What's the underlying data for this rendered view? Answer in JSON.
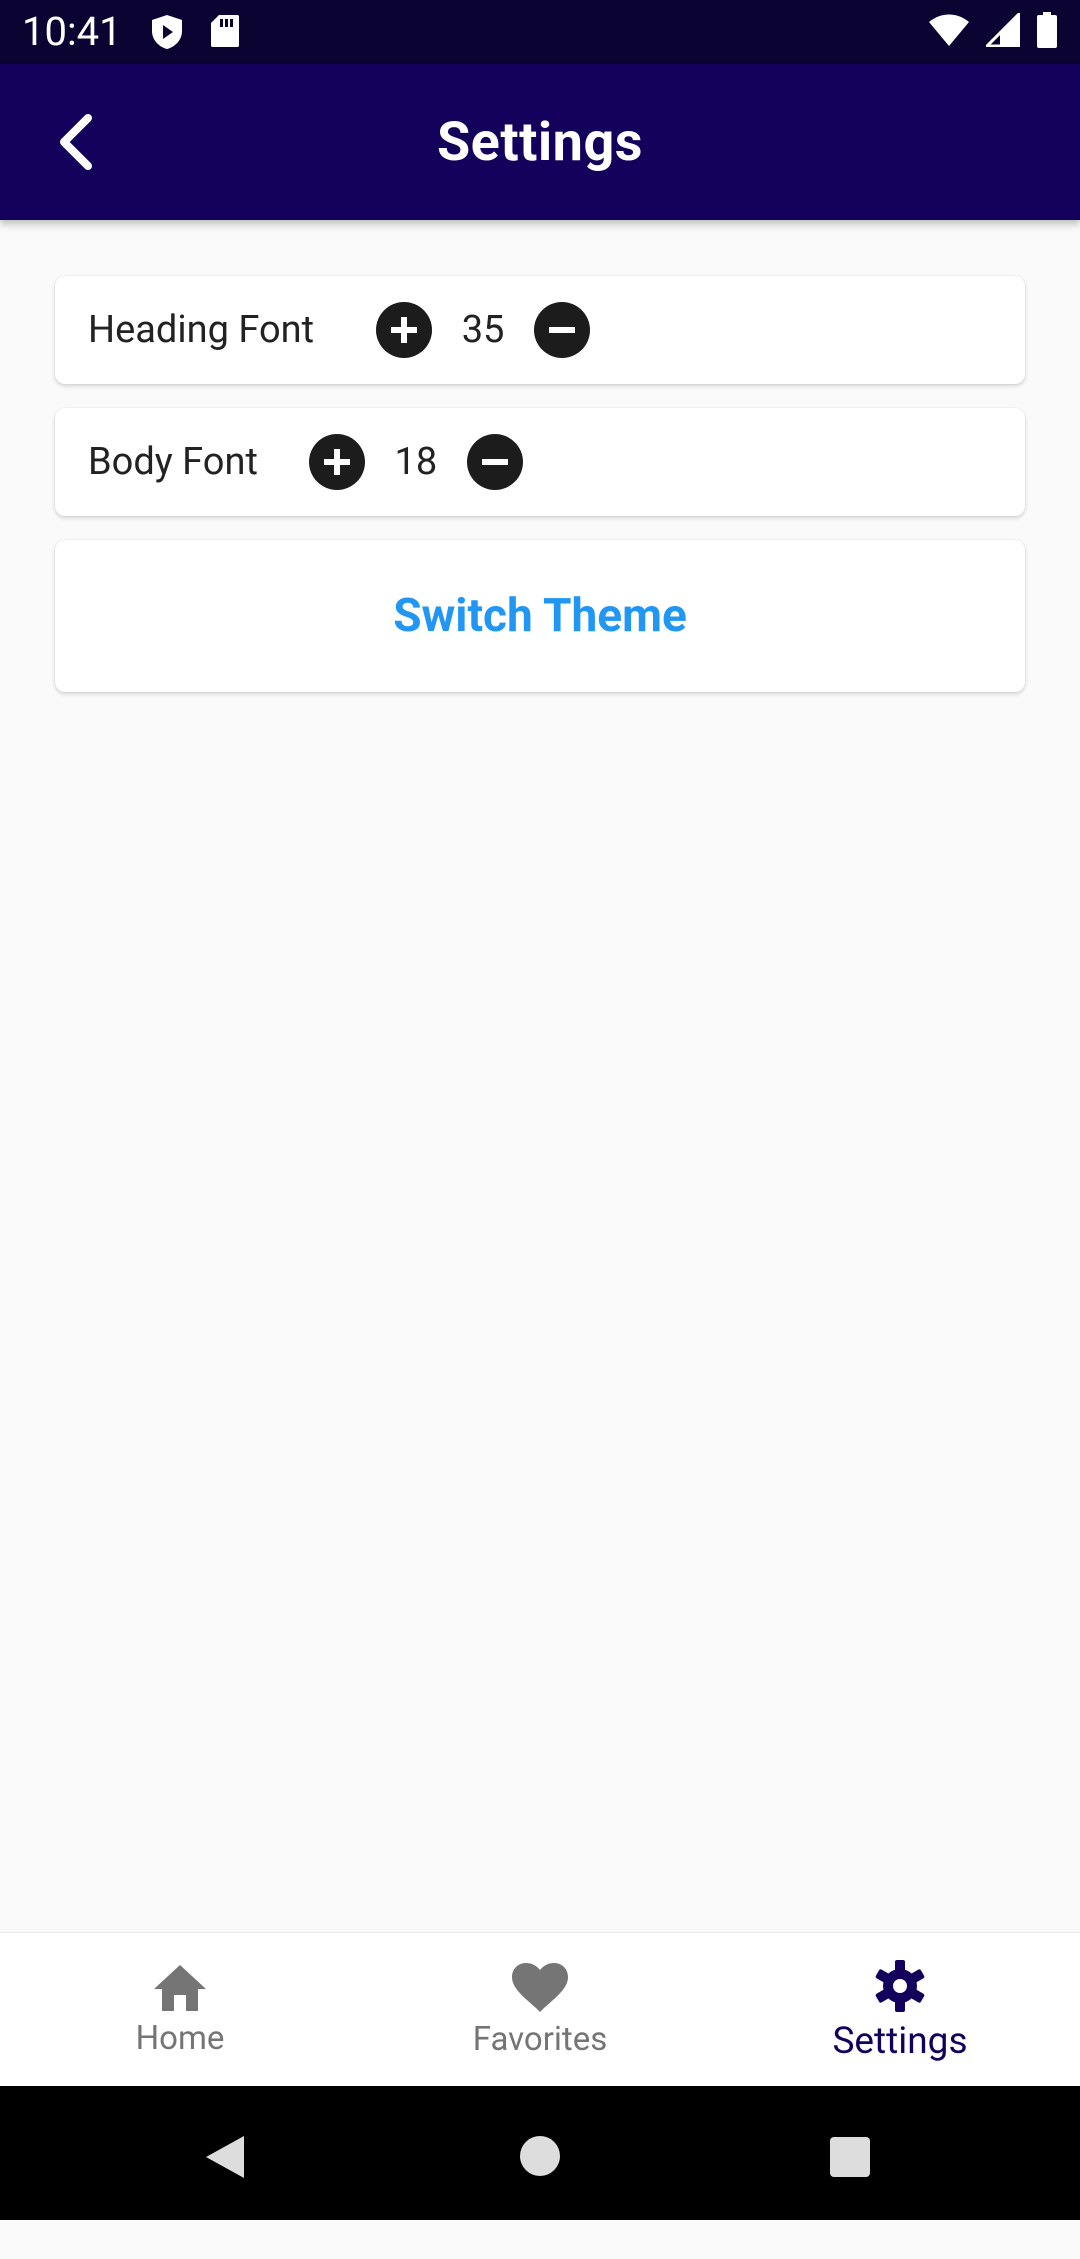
{
  "status_bar": {
    "time": "10:41",
    "left_icons": [
      "shield-play-icon",
      "sd-card-icon"
    ],
    "right_icons": [
      "wifi-icon",
      "signal-icon",
      "battery-icon"
    ]
  },
  "app_bar": {
    "title": "Settings",
    "back_icon": "chevron-left-icon",
    "background": "#14015c"
  },
  "settings": {
    "heading_font": {
      "label": "Heading Font",
      "value": "35"
    },
    "body_font": {
      "label": "Body Font",
      "value": "18"
    },
    "switch_theme_label": "Switch Theme",
    "accent_color": "#2196f3"
  },
  "bottom_nav": {
    "items": [
      {
        "label": "Home",
        "icon": "home-icon",
        "active": false
      },
      {
        "label": "Favorites",
        "icon": "heart-icon",
        "active": false
      },
      {
        "label": "Settings",
        "icon": "gear-icon",
        "active": true
      }
    ]
  },
  "system_nav": [
    "back-triangle-icon",
    "home-circle-icon",
    "recents-square-icon"
  ]
}
